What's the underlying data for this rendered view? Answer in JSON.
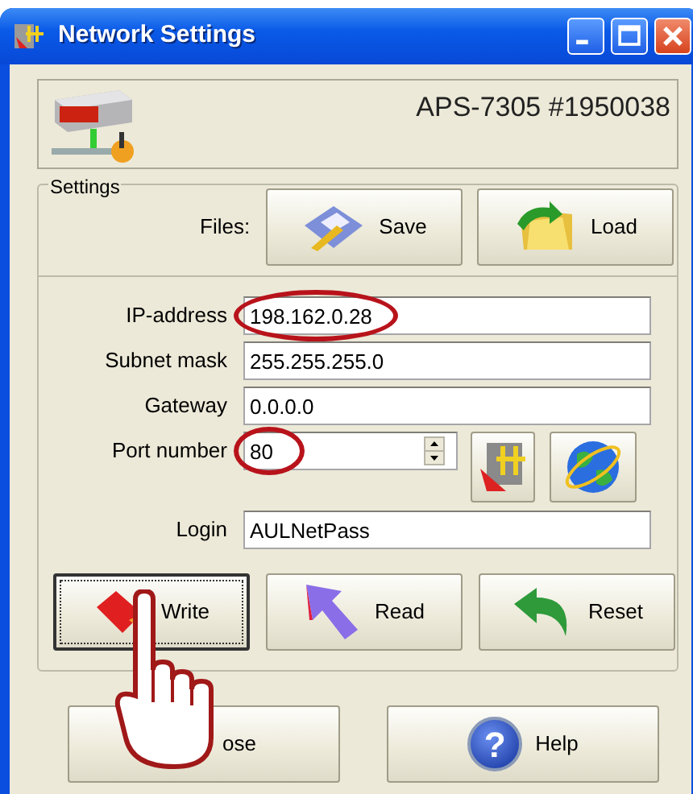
{
  "window": {
    "title": "Network Settings"
  },
  "device": {
    "model": "APS-7305 #1950038"
  },
  "settings": {
    "legend": "Settings",
    "files_label": "Files:",
    "file_buttons": [
      {
        "label": "Save",
        "kind": "save"
      },
      {
        "label": "Load",
        "kind": "load"
      }
    ],
    "fields": [
      {
        "label": "IP-address",
        "value": "198.162.0.28",
        "highlighted": true,
        "kind": "text"
      },
      {
        "label": "Subnet mask",
        "value": "255.255.255.0",
        "highlighted": false,
        "kind": "text"
      },
      {
        "label": "Gateway",
        "value": "0.0.0.0",
        "highlighted": false,
        "kind": "text"
      },
      {
        "label": "Port number",
        "value": "80",
        "highlighted": true,
        "kind": "spin"
      },
      {
        "label": "Login",
        "value": "AULNetPass",
        "highlighted": false,
        "kind": "text"
      }
    ],
    "tool_buttons": [
      {
        "kind": "tool"
      },
      {
        "kind": "globe"
      }
    ],
    "action_buttons": [
      {
        "label": "Write",
        "kind": "write",
        "focused": true
      },
      {
        "label": "Read",
        "kind": "read",
        "focused": false
      },
      {
        "label": "Reset",
        "kind": "reset",
        "focused": false
      }
    ]
  },
  "bottom_buttons": [
    {
      "label": "ose",
      "kind": "close"
    },
    {
      "label": "Help",
      "kind": "help",
      "glyph": "?"
    }
  ],
  "pointer": {
    "kind": "hand"
  }
}
